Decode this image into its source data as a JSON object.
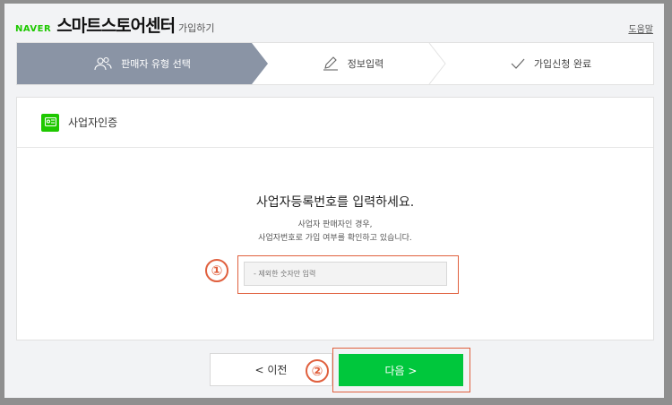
{
  "header": {
    "logo": "NAVER",
    "title": "스마트스토어센터",
    "subtitle": "가입하기",
    "help": "도움말"
  },
  "steps": [
    {
      "label": "판매자 유형 선택",
      "icon": "users-icon",
      "active": true
    },
    {
      "label": "정보입력",
      "icon": "pencil-icon",
      "active": false
    },
    {
      "label": "가입신청 완료",
      "icon": "check-icon",
      "active": false
    }
  ],
  "card": {
    "title": "사업자인증",
    "icon": "business-id-icon",
    "headline": "사업자등록번호를 입력하세요.",
    "desc_line1": "사업자 판매자인 경우,",
    "desc_line2": "사업자번호로 가입 여부를 확인하고 있습니다.",
    "input_placeholder": "- 제외한 숫자만 입력",
    "input_value": ""
  },
  "annotations": {
    "badge1": "①",
    "badge2": "②",
    "color": "#e0603e"
  },
  "buttons": {
    "prev": "< 이전",
    "next": "다음 >"
  },
  "colors": {
    "brand_green": "#1ec800",
    "button_green": "#00c73c",
    "active_step": "#8a94a5"
  }
}
